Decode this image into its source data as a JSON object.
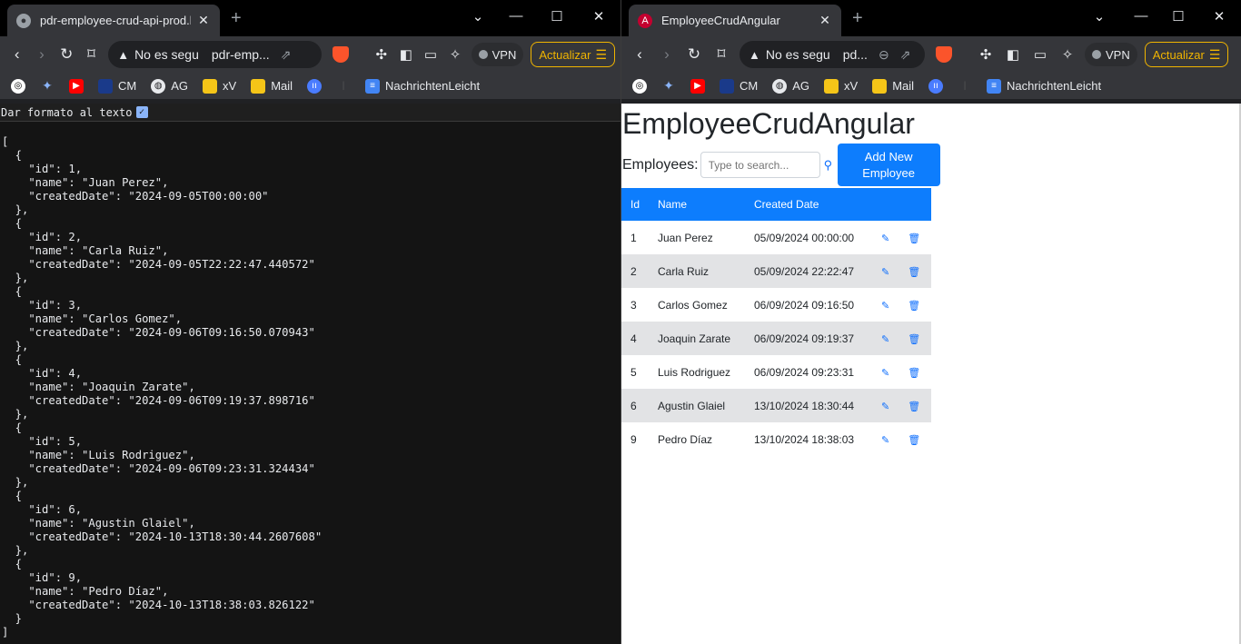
{
  "left_window": {
    "tab_title": "pdr-employee-crud-api-prod.b",
    "address_security": "No es segu",
    "address_host": "pdr-emp...",
    "vpn_label": "VPN",
    "update_label": "Actualizar",
    "bookmarks": [
      "CM",
      "AG",
      "xV",
      "Mail",
      "NachrichtenLeicht"
    ],
    "pretty_print_label": "Dar formato al texto",
    "json_text": "[\n  {\n    \"id\": 1,\n    \"name\": \"Juan Perez\",\n    \"createdDate\": \"2024-09-05T00:00:00\"\n  },\n  {\n    \"id\": 2,\n    \"name\": \"Carla Ruiz\",\n    \"createdDate\": \"2024-09-05T22:22:47.440572\"\n  },\n  {\n    \"id\": 3,\n    \"name\": \"Carlos Gomez\",\n    \"createdDate\": \"2024-09-06T09:16:50.070943\"\n  },\n  {\n    \"id\": 4,\n    \"name\": \"Joaquin Zarate\",\n    \"createdDate\": \"2024-09-06T09:19:37.898716\"\n  },\n  {\n    \"id\": 5,\n    \"name\": \"Luis Rodriguez\",\n    \"createdDate\": \"2024-09-06T09:23:31.324434\"\n  },\n  {\n    \"id\": 6,\n    \"name\": \"Agustin Glaiel\",\n    \"createdDate\": \"2024-10-13T18:30:44.2607608\"\n  },\n  {\n    \"id\": 9,\n    \"name\": \"Pedro Díaz\",\n    \"createdDate\": \"2024-10-13T18:38:03.826122\"\n  }\n]"
  },
  "right_window": {
    "tab_title": "EmployeeCrudAngular",
    "address_security": "No es segu",
    "address_host": "pd...",
    "vpn_label": "VPN",
    "update_label": "Actualizar",
    "bookmarks": [
      "CM",
      "AG",
      "xV",
      "Mail",
      "NachrichtenLeicht"
    ],
    "app": {
      "title": "EmployeeCrudAngular",
      "employees_label": "Employees:",
      "search_placeholder": "Type to search...",
      "add_button_line1": "Add New",
      "add_button_line2": "Employee",
      "columns": [
        "Id",
        "Name",
        "Created Date"
      ],
      "rows": [
        {
          "id": "1",
          "name": "Juan Perez",
          "created": "05/09/2024 00:00:00"
        },
        {
          "id": "2",
          "name": "Carla Ruiz",
          "created": "05/09/2024 22:22:47"
        },
        {
          "id": "3",
          "name": "Carlos Gomez",
          "created": "06/09/2024 09:16:50"
        },
        {
          "id": "4",
          "name": "Joaquin Zarate",
          "created": "06/09/2024 09:19:37"
        },
        {
          "id": "5",
          "name": "Luis Rodriguez",
          "created": "06/09/2024 09:23:31"
        },
        {
          "id": "6",
          "name": "Agustin Glaiel",
          "created": "13/10/2024 18:30:44"
        },
        {
          "id": "9",
          "name": "Pedro Díaz",
          "created": "13/10/2024 18:38:03"
        }
      ]
    }
  },
  "colors": {
    "primary": "#0d7dfd",
    "striped_row": "#e2e3e5",
    "update_accent": "#f0b400"
  }
}
